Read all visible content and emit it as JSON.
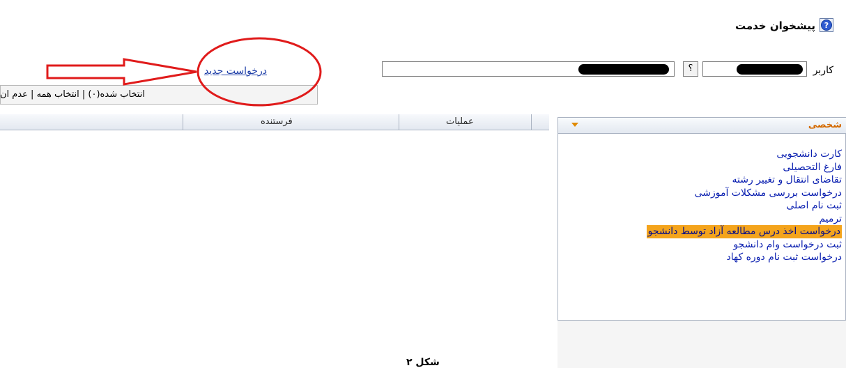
{
  "header": {
    "title": "پیشخوان خدمت",
    "help_icon": "help-circle-icon"
  },
  "user_row": {
    "label": "کاربر",
    "field1_value": "",
    "lookup_button": "؟",
    "field2_value": ""
  },
  "actions": {
    "new_request": "درخواست جدید"
  },
  "toolbar": {
    "text": "انتخاب شده(۰) | انتخاب همه | عدم ان"
  },
  "grid": {
    "columns": [
      "عملیات",
      "فرستنده"
    ]
  },
  "sidebar": {
    "title": "شخصی",
    "items": [
      {
        "label": "کارت دانشجویی"
      },
      {
        "label": "فارغ التحصیلی"
      },
      {
        "label": "تقاضای انتقال و تغییر رشته"
      },
      {
        "label": "درخواست بررسی مشکلات آموزشی"
      },
      {
        "label": "ثبت نام اصلی"
      },
      {
        "label": "ترمیم"
      },
      {
        "label": "درخواست اخذ درس مطالعه آزاد توسط دانشجو",
        "highlighted": true
      },
      {
        "label": "ثبت درخواست وام دانشجو"
      },
      {
        "label": "درخواست ثبت نام دوره کهاد"
      }
    ]
  },
  "caption": "شکل ۲",
  "colors": {
    "link": "#1f3fa8",
    "menu_item": "#0a1fb0",
    "highlight": "#f4a41c",
    "annotation": "#e01b1b",
    "section_title": "#d46a00"
  }
}
